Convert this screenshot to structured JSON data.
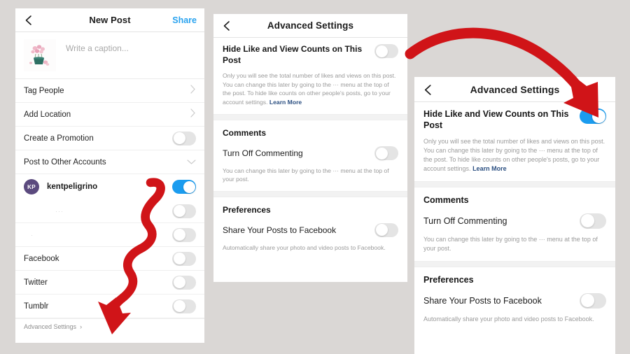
{
  "colors": {
    "background": "#dad7d5",
    "accent_blue": "#1b9cef",
    "share_blue": "#2aa3ef",
    "annotation_red": "#d01418",
    "avatar_purple": "#5b4a7e",
    "toggle_off": "#e4e4e4",
    "learn_more_link": "#2b4f81"
  },
  "panel1": {
    "nav": {
      "back_icon": "chevron-left-icon",
      "title": "New Post",
      "action": "Share"
    },
    "caption": {
      "placeholder": "Write a caption...",
      "thumbnail": "flower-pot-photo"
    },
    "rows": [
      {
        "label": "Tag People",
        "type": "chevron"
      },
      {
        "label": "Add Location",
        "type": "chevron"
      },
      {
        "label": "Create a Promotion",
        "type": "toggle",
        "on": false
      },
      {
        "label": "Post to Other Accounts",
        "type": "chevron-down"
      }
    ],
    "account": {
      "initials": "KP",
      "name": "kentpeligrino",
      "toggle_on": true
    },
    "blank_rows": [
      {
        "label": "",
        "toggle_on": false
      },
      {
        "label": "",
        "toggle_on": false
      }
    ],
    "social_rows": [
      {
        "label": "Facebook",
        "toggle_on": false
      },
      {
        "label": "Twitter",
        "toggle_on": false
      },
      {
        "label": "Tumblr",
        "toggle_on": false
      }
    ],
    "advanced": {
      "label": "Advanced Settings",
      "chevron": "›"
    }
  },
  "panel2": {
    "nav": {
      "back_icon": "chevron-left-icon",
      "title": "Advanced Settings"
    },
    "hide_likes": {
      "title": "Hide Like and View Counts on This Post",
      "toggle_on": false,
      "description": "Only you will see the total number of likes and views on this post. You can change this later by going to the ··· menu at the top of the post. To hide like counts on other people's posts, go to your account settings.",
      "learn_more": "Learn More"
    },
    "comments": {
      "section": "Comments",
      "row_label": "Turn Off Commenting",
      "toggle_on": false,
      "description": "You can change this later by going to the ··· menu at the top of your post."
    },
    "preferences": {
      "section": "Preferences",
      "row_label": "Share Your Posts to Facebook",
      "toggle_on": false,
      "description": "Automatically share your photo and video posts to Facebook."
    }
  },
  "panel3": {
    "nav": {
      "back_icon": "chevron-left-icon",
      "title": "Advanced Settings"
    },
    "hide_likes": {
      "title": "Hide Like and View Counts on This Post",
      "toggle_on": true,
      "description": "Only you will see the total number of likes and views on this post. You can change this later by going to the ··· menu at the top of the post. To hide like counts on other people's posts, go to your account settings.",
      "learn_more": "Learn More"
    },
    "comments": {
      "section": "Comments",
      "row_label": "Turn Off Commenting",
      "toggle_on": false,
      "description": "You can change this later by going to the ··· menu at the top of your post."
    },
    "preferences": {
      "section": "Preferences",
      "row_label": "Share Your Posts to Facebook",
      "toggle_on": false,
      "description": "Automatically share your photo and video posts to Facebook."
    }
  },
  "annotations": [
    {
      "name": "squiggly-arrow-down",
      "target": "Advanced Settings link"
    },
    {
      "name": "curved-arrow-right",
      "target": "Hide Like and View Counts toggle"
    }
  ]
}
